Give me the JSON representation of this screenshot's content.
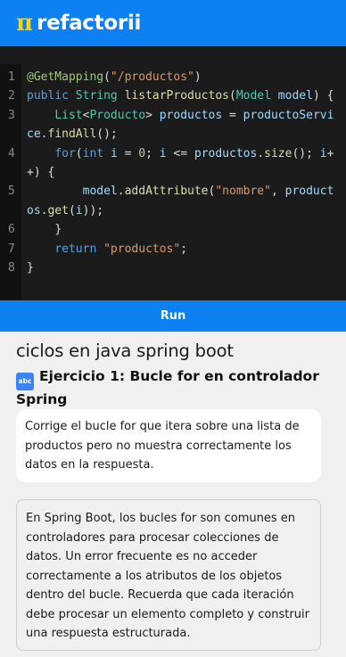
{
  "header": {
    "logo_symbol": "π",
    "logo_text": "refactorii"
  },
  "editor": {
    "line_numbers": [
      "1",
      "2",
      "3",
      "4",
      "5",
      "6",
      "7",
      "8"
    ],
    "run_label": "Run"
  },
  "content": {
    "topic_title": "ciclos en java spring boot",
    "exercise_icon": "abc",
    "exercise_title": "Ejercicio 1: Bucle for en controlador Spring",
    "prompt": "Corrige el bucle for que itera sobre una lista de productos pero no muestra correctamente los datos en la respuesta.",
    "description": "En Spring Boot, los bucles for son comunes en controladores para procesar colecciones de datos. Un error frecuente es no acceder correctamente a los atributos de los objetos dentro del bucle. Recuerda que cada iteración debe procesar un elemento completo y construir una respuesta estructurada."
  },
  "colors": {
    "brand_blue": "#0d80f2",
    "logo_yellow": "#ffd200",
    "editor_bg": "#1b1b1b"
  },
  "icons": {
    "exercise": "abc-input-icon"
  }
}
